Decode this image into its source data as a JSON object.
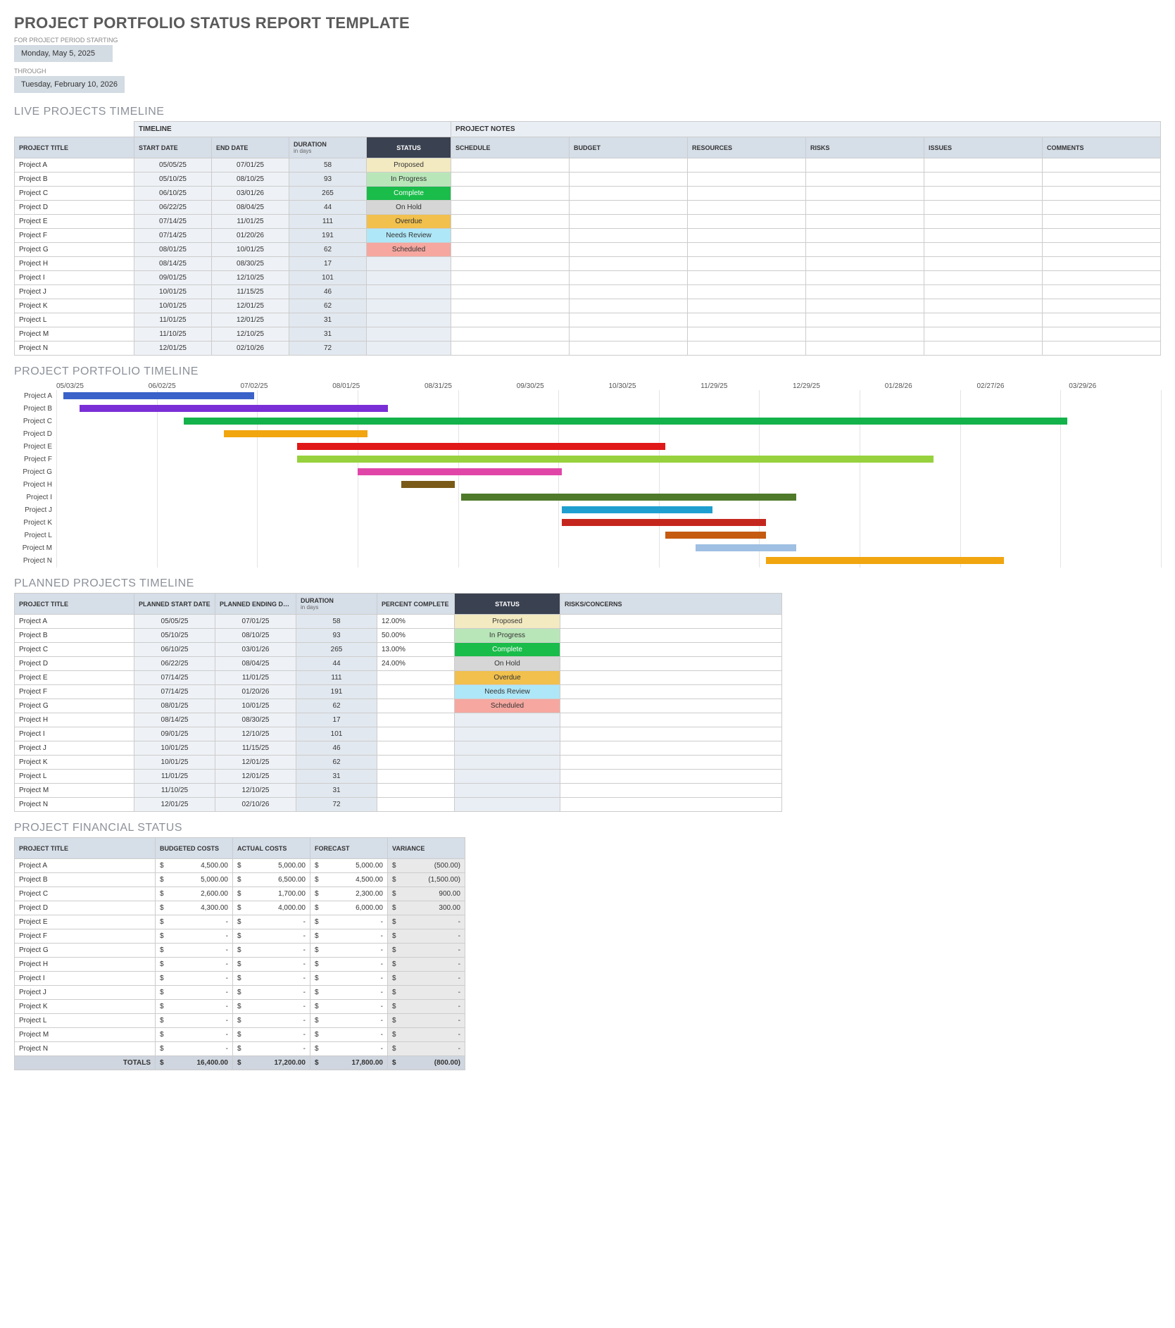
{
  "header": {
    "title": "PROJECT PORTFOLIO STATUS REPORT TEMPLATE",
    "period_start_label": "FOR PROJECT PERIOD STARTING",
    "period_start": "Monday, May 5, 2025",
    "through_label": "THROUGH",
    "period_end": "Tuesday, February 10, 2026"
  },
  "sections": {
    "live": "LIVE PROJECTS TIMELINE",
    "gantt": "PROJECT PORTFOLIO TIMELINE",
    "planned": "PLANNED PROJECTS TIMELINE",
    "financial": "PROJECT FINANCIAL STATUS"
  },
  "live": {
    "group_headers": {
      "timeline": "TIMELINE",
      "notes": "PROJECT NOTES"
    },
    "columns": {
      "title": "PROJECT TITLE",
      "start": "START DATE",
      "end": "END DATE",
      "duration": "DURATION",
      "duration_sub": "in days",
      "status": "STATUS",
      "schedule": "SCHEDULE",
      "budget": "BUDGET",
      "resources": "RESOURCES",
      "risks": "RISKS",
      "issues": "ISSUES",
      "comments": "COMMENTS"
    },
    "rows": [
      {
        "title": "Project A",
        "start": "05/05/25",
        "end": "07/01/25",
        "duration": "58",
        "status": "Proposed"
      },
      {
        "title": "Project B",
        "start": "05/10/25",
        "end": "08/10/25",
        "duration": "93",
        "status": "In Progress"
      },
      {
        "title": "Project C",
        "start": "06/10/25",
        "end": "03/01/26",
        "duration": "265",
        "status": "Complete"
      },
      {
        "title": "Project D",
        "start": "06/22/25",
        "end": "08/04/25",
        "duration": "44",
        "status": "On Hold"
      },
      {
        "title": "Project E",
        "start": "07/14/25",
        "end": "11/01/25",
        "duration": "111",
        "status": "Overdue"
      },
      {
        "title": "Project F",
        "start": "07/14/25",
        "end": "01/20/26",
        "duration": "191",
        "status": "Needs Review"
      },
      {
        "title": "Project G",
        "start": "08/01/25",
        "end": "10/01/25",
        "duration": "62",
        "status": "Scheduled"
      },
      {
        "title": "Project H",
        "start": "08/14/25",
        "end": "08/30/25",
        "duration": "17",
        "status": ""
      },
      {
        "title": "Project I",
        "start": "09/01/25",
        "end": "12/10/25",
        "duration": "101",
        "status": ""
      },
      {
        "title": "Project J",
        "start": "10/01/25",
        "end": "11/15/25",
        "duration": "46",
        "status": ""
      },
      {
        "title": "Project K",
        "start": "10/01/25",
        "end": "12/01/25",
        "duration": "62",
        "status": ""
      },
      {
        "title": "Project L",
        "start": "11/01/25",
        "end": "12/01/25",
        "duration": "31",
        "status": ""
      },
      {
        "title": "Project M",
        "start": "11/10/25",
        "end": "12/10/25",
        "duration": "31",
        "status": ""
      },
      {
        "title": "Project N",
        "start": "12/01/25",
        "end": "02/10/26",
        "duration": "72",
        "status": ""
      }
    ]
  },
  "gantt": {
    "start": "2025-05-03",
    "days": 330,
    "ticks": [
      "05/03/25",
      "06/02/25",
      "07/02/25",
      "08/01/25",
      "08/31/25",
      "09/30/25",
      "10/30/25",
      "11/29/25",
      "12/29/25",
      "01/28/26",
      "02/27/26",
      "03/29/26"
    ],
    "bars": [
      {
        "label": "Project A",
        "start": "2025-05-05",
        "end": "2025-07-01",
        "color": "#3a62c9"
      },
      {
        "label": "Project B",
        "start": "2025-05-10",
        "end": "2025-08-10",
        "color": "#7a2fd6"
      },
      {
        "label": "Project C",
        "start": "2025-06-10",
        "end": "2026-03-01",
        "color": "#14b24b"
      },
      {
        "label": "Project D",
        "start": "2025-06-22",
        "end": "2025-08-04",
        "color": "#f1a50f"
      },
      {
        "label": "Project E",
        "start": "2025-07-14",
        "end": "2025-11-01",
        "color": "#e11818"
      },
      {
        "label": "Project F",
        "start": "2025-07-14",
        "end": "2026-01-20",
        "color": "#97d13d"
      },
      {
        "label": "Project G",
        "start": "2025-08-01",
        "end": "2025-10-01",
        "color": "#e046a8"
      },
      {
        "label": "Project H",
        "start": "2025-08-14",
        "end": "2025-08-30",
        "color": "#7a5a17"
      },
      {
        "label": "Project I",
        "start": "2025-09-01",
        "end": "2025-12-10",
        "color": "#4f7a2a"
      },
      {
        "label": "Project J",
        "start": "2025-10-01",
        "end": "2025-11-15",
        "color": "#1f9fcf"
      },
      {
        "label": "Project K",
        "start": "2025-10-01",
        "end": "2025-12-01",
        "color": "#c4261d"
      },
      {
        "label": "Project L",
        "start": "2025-11-01",
        "end": "2025-12-01",
        "color": "#c55a11"
      },
      {
        "label": "Project M",
        "start": "2025-11-10",
        "end": "2025-12-10",
        "color": "#9fbfe3"
      },
      {
        "label": "Project N",
        "start": "2025-12-01",
        "end": "2026-02-10",
        "color": "#f1a50f"
      }
    ]
  },
  "planned": {
    "columns": {
      "title": "PROJECT TITLE",
      "start": "PLANNED START DATE",
      "end": "PLANNED ENDING DATE",
      "duration": "DURATION",
      "duration_sub": "in days",
      "pct": "PERCENT COMPLETE",
      "status": "STATUS",
      "risks": "RISKS/CONCERNS"
    },
    "rows": [
      {
        "title": "Project A",
        "start": "05/05/25",
        "end": "07/01/25",
        "duration": "58",
        "pct": "12.00%",
        "status": "Proposed"
      },
      {
        "title": "Project B",
        "start": "05/10/25",
        "end": "08/10/25",
        "duration": "93",
        "pct": "50.00%",
        "status": "In Progress"
      },
      {
        "title": "Project C",
        "start": "06/10/25",
        "end": "03/01/26",
        "duration": "265",
        "pct": "13.00%",
        "status": "Complete"
      },
      {
        "title": "Project D",
        "start": "06/22/25",
        "end": "08/04/25",
        "duration": "44",
        "pct": "24.00%",
        "status": "On Hold"
      },
      {
        "title": "Project E",
        "start": "07/14/25",
        "end": "11/01/25",
        "duration": "111",
        "pct": "",
        "status": "Overdue"
      },
      {
        "title": "Project F",
        "start": "07/14/25",
        "end": "01/20/26",
        "duration": "191",
        "pct": "",
        "status": "Needs Review"
      },
      {
        "title": "Project G",
        "start": "08/01/25",
        "end": "10/01/25",
        "duration": "62",
        "pct": "",
        "status": "Scheduled"
      },
      {
        "title": "Project H",
        "start": "08/14/25",
        "end": "08/30/25",
        "duration": "17",
        "pct": "",
        "status": ""
      },
      {
        "title": "Project I",
        "start": "09/01/25",
        "end": "12/10/25",
        "duration": "101",
        "pct": "",
        "status": ""
      },
      {
        "title": "Project J",
        "start": "10/01/25",
        "end": "11/15/25",
        "duration": "46",
        "pct": "",
        "status": ""
      },
      {
        "title": "Project K",
        "start": "10/01/25",
        "end": "12/01/25",
        "duration": "62",
        "pct": "",
        "status": ""
      },
      {
        "title": "Project L",
        "start": "11/01/25",
        "end": "12/01/25",
        "duration": "31",
        "pct": "",
        "status": ""
      },
      {
        "title": "Project M",
        "start": "11/10/25",
        "end": "12/10/25",
        "duration": "31",
        "pct": "",
        "status": ""
      },
      {
        "title": "Project N",
        "start": "12/01/25",
        "end": "02/10/26",
        "duration": "72",
        "pct": "",
        "status": ""
      }
    ]
  },
  "financial": {
    "columns": {
      "title": "PROJECT TITLE",
      "budgeted": "BUDGETED COSTS",
      "actual": "ACTUAL COSTS",
      "forecast": "FORECAST",
      "variance": "VARIANCE"
    },
    "rows": [
      {
        "title": "Project A",
        "budgeted": "4,500.00",
        "actual": "5,000.00",
        "forecast": "5,000.00",
        "variance": "(500.00)"
      },
      {
        "title": "Project B",
        "budgeted": "5,000.00",
        "actual": "6,500.00",
        "forecast": "4,500.00",
        "variance": "(1,500.00)"
      },
      {
        "title": "Project C",
        "budgeted": "2,600.00",
        "actual": "1,700.00",
        "forecast": "2,300.00",
        "variance": "900.00"
      },
      {
        "title": "Project D",
        "budgeted": "4,300.00",
        "actual": "4,000.00",
        "forecast": "6,000.00",
        "variance": "300.00"
      },
      {
        "title": "Project E",
        "budgeted": "-",
        "actual": "-",
        "forecast": "-",
        "variance": "-"
      },
      {
        "title": "Project F",
        "budgeted": "-",
        "actual": "-",
        "forecast": "-",
        "variance": "-"
      },
      {
        "title": "Project G",
        "budgeted": "-",
        "actual": "-",
        "forecast": "-",
        "variance": "-"
      },
      {
        "title": "Project H",
        "budgeted": "-",
        "actual": "-",
        "forecast": "-",
        "variance": "-"
      },
      {
        "title": "Project I",
        "budgeted": "-",
        "actual": "-",
        "forecast": "-",
        "variance": "-"
      },
      {
        "title": "Project J",
        "budgeted": "-",
        "actual": "-",
        "forecast": "-",
        "variance": "-"
      },
      {
        "title": "Project K",
        "budgeted": "-",
        "actual": "-",
        "forecast": "-",
        "variance": "-"
      },
      {
        "title": "Project L",
        "budgeted": "-",
        "actual": "-",
        "forecast": "-",
        "variance": "-"
      },
      {
        "title": "Project M",
        "budgeted": "-",
        "actual": "-",
        "forecast": "-",
        "variance": "-"
      },
      {
        "title": "Project N",
        "budgeted": "-",
        "actual": "-",
        "forecast": "-",
        "variance": "-"
      }
    ],
    "totals": {
      "label": "TOTALS",
      "budgeted": "16,400.00",
      "actual": "17,200.00",
      "forecast": "17,800.00",
      "variance": "(800.00)"
    }
  },
  "chart_data": {
    "type": "gantt",
    "title": "PROJECT PORTFOLIO TIMELINE",
    "x_axis_ticks": [
      "05/03/25",
      "06/02/25",
      "07/02/25",
      "08/01/25",
      "08/31/25",
      "09/30/25",
      "10/30/25",
      "11/29/25",
      "12/29/25",
      "01/28/26",
      "02/27/26",
      "03/29/26"
    ],
    "series": [
      {
        "name": "Project A",
        "start": "2025-05-05",
        "end": "2025-07-01",
        "color": "#3a62c9"
      },
      {
        "name": "Project B",
        "start": "2025-05-10",
        "end": "2025-08-10",
        "color": "#7a2fd6"
      },
      {
        "name": "Project C",
        "start": "2025-06-10",
        "end": "2026-03-01",
        "color": "#14b24b"
      },
      {
        "name": "Project D",
        "start": "2025-06-22",
        "end": "2025-08-04",
        "color": "#f1a50f"
      },
      {
        "name": "Project E",
        "start": "2025-07-14",
        "end": "2025-11-01",
        "color": "#e11818"
      },
      {
        "name": "Project F",
        "start": "2025-07-14",
        "end": "2026-01-20",
        "color": "#97d13d"
      },
      {
        "name": "Project G",
        "start": "2025-08-01",
        "end": "2025-10-01",
        "color": "#e046a8"
      },
      {
        "name": "Project H",
        "start": "2025-08-14",
        "end": "2025-08-30",
        "color": "#7a5a17"
      },
      {
        "name": "Project I",
        "start": "2025-09-01",
        "end": "2025-12-10",
        "color": "#4f7a2a"
      },
      {
        "name": "Project J",
        "start": "2025-10-01",
        "end": "2025-11-15",
        "color": "#1f9fcf"
      },
      {
        "name": "Project K",
        "start": "2025-10-01",
        "end": "2025-12-01",
        "color": "#c4261d"
      },
      {
        "name": "Project L",
        "start": "2025-11-01",
        "end": "2025-12-01",
        "color": "#c55a11"
      },
      {
        "name": "Project M",
        "start": "2025-11-10",
        "end": "2025-12-10",
        "color": "#9fbfe3"
      },
      {
        "name": "Project N",
        "start": "2025-12-01",
        "end": "2026-02-10",
        "color": "#f1a50f"
      }
    ]
  }
}
